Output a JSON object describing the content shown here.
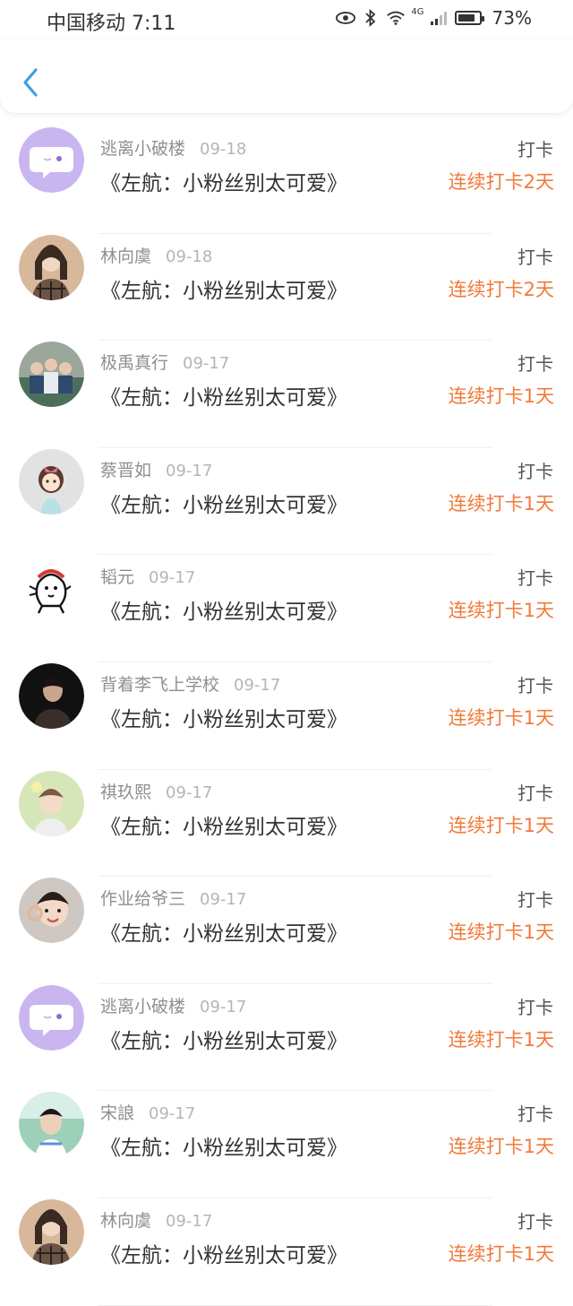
{
  "status_bar": {
    "carrier_time": "中国移动 7:11",
    "network": "4G",
    "battery": "73%"
  },
  "colors": {
    "accent_back": "#3d9ee8",
    "streak": "#f07a3a",
    "bubble_bg": "#c9b6f0"
  },
  "entries": [
    {
      "user": "逃离小破楼",
      "date": "09-18",
      "title": "《左航：小粉丝别太可爱》",
      "action": "打卡",
      "streak": "连续打卡2天",
      "avatar": "chat-bubble"
    },
    {
      "user": "林向虞",
      "date": "09-18",
      "title": "《左航：小粉丝别太可爱》",
      "action": "打卡",
      "streak": "连续打卡2天",
      "avatar": "photo-girl-plaid"
    },
    {
      "user": "极禹真行",
      "date": "09-17",
      "title": "《左航：小粉丝别太可爱》",
      "action": "打卡",
      "streak": "连续打卡1天",
      "avatar": "photo-group"
    },
    {
      "user": "蔡晋如",
      "date": "09-17",
      "title": "《左航：小粉丝别太可爱》",
      "action": "打卡",
      "streak": "连续打卡1天",
      "avatar": "cartoon-girl"
    },
    {
      "user": "韬元",
      "date": "09-17",
      "title": "《左航：小粉丝别太可爱》",
      "action": "打卡",
      "streak": "连续打卡1天",
      "avatar": "sketch-cat"
    },
    {
      "user": "背着李飞上学校",
      "date": "09-17",
      "title": "《左航：小粉丝别太可爱》",
      "action": "打卡",
      "streak": "连续打卡1天",
      "avatar": "photo-dark"
    },
    {
      "user": "祺玖熙",
      "date": "09-17",
      "title": "《左航：小粉丝别太可爱》",
      "action": "打卡",
      "streak": "连续打卡1天",
      "avatar": "photo-boy-light"
    },
    {
      "user": "作业给爷三",
      "date": "09-17",
      "title": "《左航：小粉丝别太可爱》",
      "action": "打卡",
      "streak": "连续打卡1天",
      "avatar": "photo-boy-smile"
    },
    {
      "user": "逃离小破楼",
      "date": "09-17",
      "title": "《左航：小粉丝别太可爱》",
      "action": "打卡",
      "streak": "连续打卡1天",
      "avatar": "chat-bubble"
    },
    {
      "user": "宋誏",
      "date": "09-17",
      "title": "《左航：小粉丝别太可爱》",
      "action": "打卡",
      "streak": "连续打卡1天",
      "avatar": "photo-boy-outdoor"
    },
    {
      "user": "林向虞",
      "date": "09-17",
      "title": "《左航：小粉丝别太可爱》",
      "action": "打卡",
      "streak": "连续打卡1天",
      "avatar": "photo-girl-plaid"
    }
  ]
}
